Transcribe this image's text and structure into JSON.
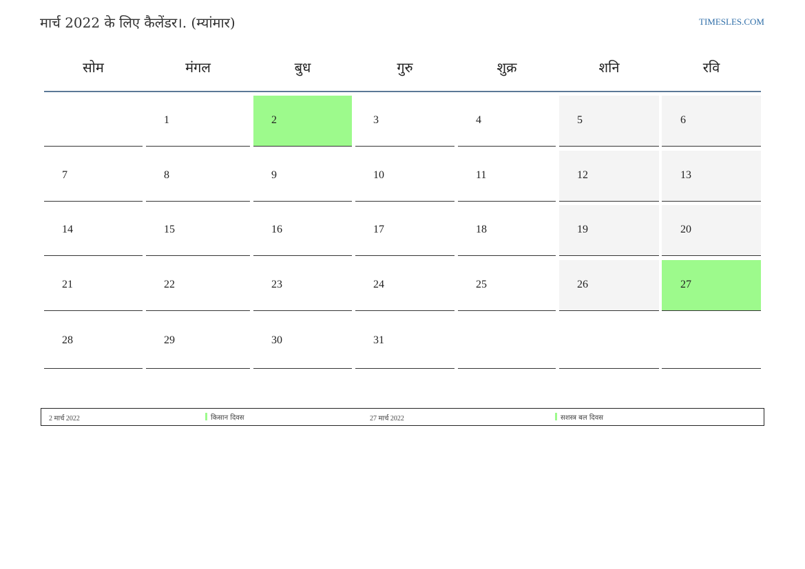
{
  "header": {
    "title": "मार्च 2022 के लिए कैलेंडर।. (म्यांमार)",
    "site": "TIMESLES.COM"
  },
  "weekdays": [
    "सोम",
    "मंगल",
    "बुध",
    "गुरु",
    "शुक्र",
    "शनि",
    "रवि"
  ],
  "weeks": [
    [
      "",
      "1",
      "2",
      "3",
      "4",
      "5",
      "6"
    ],
    [
      "7",
      "8",
      "9",
      "10",
      "11",
      "12",
      "13"
    ],
    [
      "14",
      "15",
      "16",
      "17",
      "18",
      "19",
      "20"
    ],
    [
      "21",
      "22",
      "23",
      "24",
      "25",
      "26",
      "27"
    ],
    [
      "28",
      "29",
      "30",
      "31",
      "",
      "",
      ""
    ]
  ],
  "legend": [
    {
      "date": "2 मार्च 2022",
      "name": "किसान दिवस"
    },
    {
      "date": "27 मार्च 2022",
      "name": "सशस्त्र बल दिवस"
    }
  ],
  "colors": {
    "holiday": "#9dfa8c",
    "weekend": "#f4f4f4",
    "header_rule": "#5b7896",
    "site_link": "#2f6ea8"
  }
}
